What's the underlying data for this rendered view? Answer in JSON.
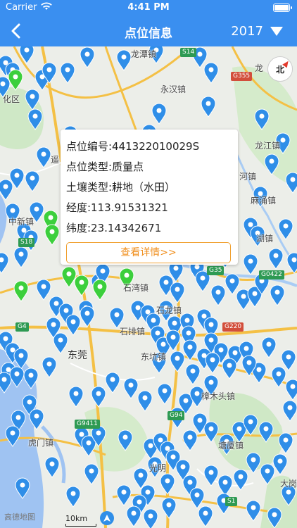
{
  "status_bar": {
    "carrier": "Carrier",
    "time": "4:41 PM"
  },
  "nav": {
    "title": "点位信息",
    "year": "2017"
  },
  "info": {
    "code": "点位编号:441322010029S",
    "type": "点位类型:质量点",
    "soil": "土壤类型:耕地（水田）",
    "lng": "经度:113.91531321",
    "lat": "纬度:23.14342671",
    "detail_label": "查看详情>>"
  },
  "map": {
    "compass_label": "北",
    "scale_label": "10km",
    "logo": "高德地图",
    "places": [
      {
        "name": "龙潭镇"
      },
      {
        "name": "永汉镇"
      },
      {
        "name": "龙江镇"
      },
      {
        "name": "河镇"
      },
      {
        "name": "麻涌镇"
      },
      {
        "name": "湖镇"
      },
      {
        "name": "中新镇"
      },
      {
        "name": "化区"
      },
      {
        "name": "遥"
      },
      {
        "name": "石湾镇"
      },
      {
        "name": "石排镇"
      },
      {
        "name": "东莞"
      },
      {
        "name": "东坑镇"
      },
      {
        "name": "樟木头镇"
      },
      {
        "name": "虎门镇"
      },
      {
        "name": "塘厦镇"
      },
      {
        "name": "光明"
      },
      {
        "name": "龙"
      },
      {
        "name": "大岗"
      },
      {
        "name": "石龙镇"
      }
    ],
    "roads": [
      {
        "name": "S14",
        "color": "green"
      },
      {
        "name": "G355",
        "color": "red"
      },
      {
        "name": "S18",
        "color": "green"
      },
      {
        "name": "G35",
        "color": "green"
      },
      {
        "name": "G0422",
        "color": "green"
      },
      {
        "name": "G220",
        "color": "red"
      },
      {
        "name": "G4",
        "color": "green"
      },
      {
        "name": "G94",
        "color": "green"
      },
      {
        "name": "G9411",
        "color": "green"
      },
      {
        "name": "S1",
        "color": "green"
      }
    ]
  },
  "colors": {
    "primary": "#3a8ff0",
    "pin_blue": "#2f8ee8",
    "pin_green": "#3ccf3c",
    "accent": "#f09020"
  }
}
